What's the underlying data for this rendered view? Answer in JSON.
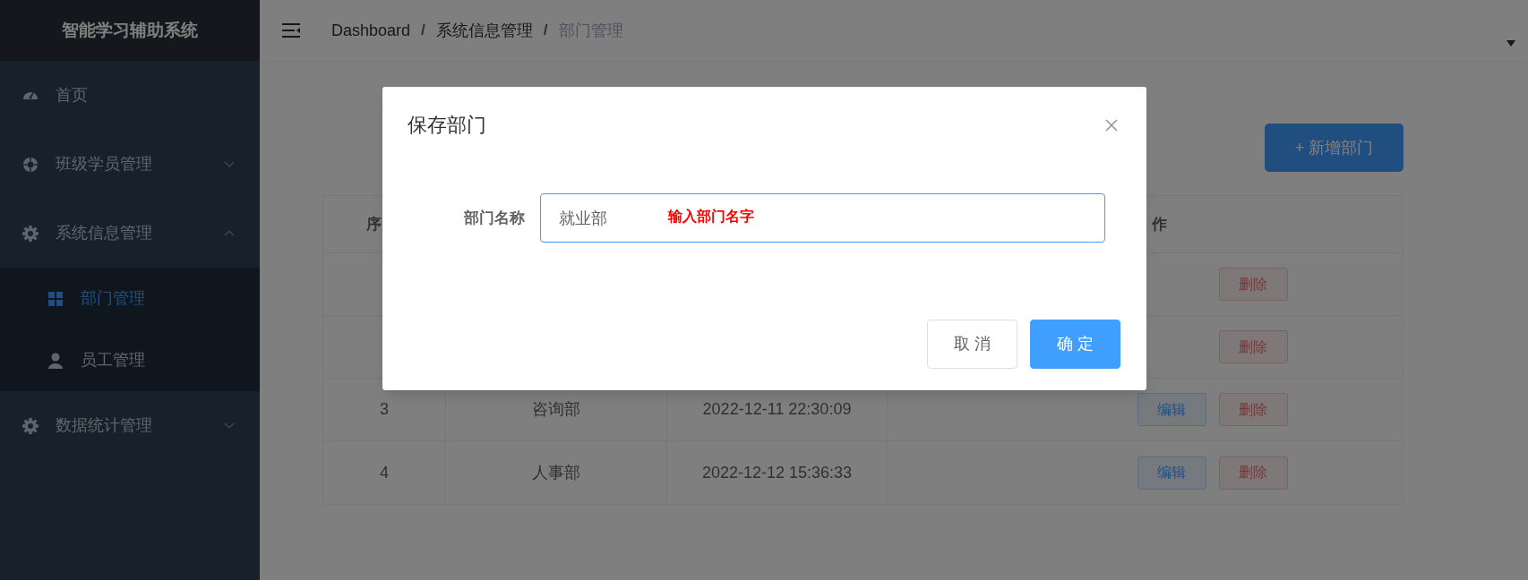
{
  "sidebar": {
    "logo": "智能学习辅助系统",
    "items": [
      {
        "label": "首页",
        "selected": false
      },
      {
        "label": "班级学员管理",
        "selected": false,
        "expanded": false
      },
      {
        "label": "系统信息管理",
        "selected": false,
        "expanded": true,
        "children": [
          {
            "label": "部门管理",
            "selected": true
          },
          {
            "label": "员工管理",
            "selected": false
          }
        ]
      },
      {
        "label": "数据统计管理",
        "selected": false,
        "expanded": false
      }
    ]
  },
  "header": {
    "breadcrumb": [
      "Dashboard",
      "系统信息管理",
      "部门管理"
    ],
    "separator": "/"
  },
  "add_button": "+ 新增部门",
  "table": {
    "columns": [
      "序",
      "作"
    ],
    "rows": [
      {
        "delete": "删除"
      },
      {
        "delete": "删除"
      },
      {
        "index": "3",
        "name": "咨询部",
        "time": "2022-12-11 22:30:09",
        "edit": "编辑",
        "delete": "删除"
      },
      {
        "index": "4",
        "name": "人事部",
        "time": "2022-12-12 15:36:33",
        "edit": "编辑",
        "delete": "删除"
      }
    ]
  },
  "dialog": {
    "title": "保存部门",
    "field_label": "部门名称",
    "field_value": "就业部",
    "annotation": "输入部门名字",
    "buttons": [
      {
        "label": "取 消",
        "kind": "secondary"
      },
      {
        "label": "确 定",
        "kind": "primary"
      }
    ]
  }
}
